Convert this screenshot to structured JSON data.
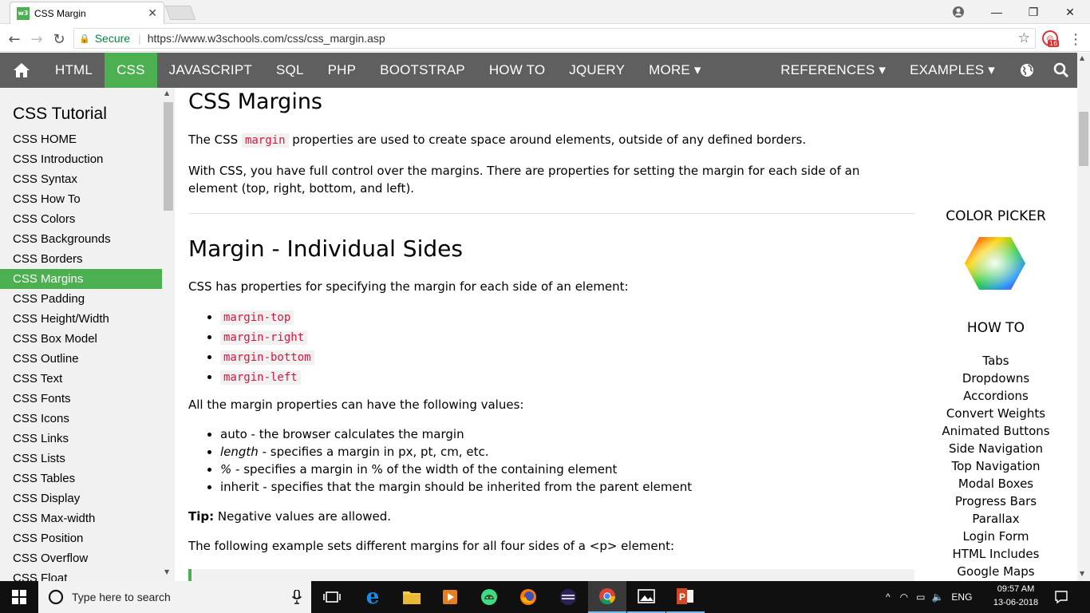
{
  "browser": {
    "tab_title": "CSS Margin",
    "favicon_text": "w3",
    "secure_label": "Secure",
    "url": "https://www.w3schools.com/css/css_margin.asp",
    "extension_badge": "16"
  },
  "topnav": {
    "items": [
      "HTML",
      "CSS",
      "JAVASCRIPT",
      "SQL",
      "PHP",
      "BOOTSTRAP",
      "HOW TO",
      "JQUERY",
      "MORE ▾"
    ],
    "active_index": 1,
    "right_items": [
      "REFERENCES ▾",
      "EXAMPLES ▾"
    ],
    "active_color": "#4caf50",
    "bar_color": "#5f5f5f"
  },
  "sidebar": {
    "title": "CSS Tutorial",
    "items": [
      "CSS HOME",
      "CSS Introduction",
      "CSS Syntax",
      "CSS How To",
      "CSS Colors",
      "CSS Backgrounds",
      "CSS Borders",
      "CSS Margins",
      "CSS Padding",
      "CSS Height/Width",
      "CSS Box Model",
      "CSS Outline",
      "CSS Text",
      "CSS Fonts",
      "CSS Icons",
      "CSS Links",
      "CSS Lists",
      "CSS Tables",
      "CSS Display",
      "CSS Max-width",
      "CSS Position",
      "CSS Overflow",
      "CSS Float"
    ],
    "active_index": 7
  },
  "main": {
    "title": "CSS Margins",
    "intro_pre": "The CSS ",
    "intro_code": "margin",
    "intro_post": " properties are used to create space around elements, outside of any defined borders.",
    "para2": "With CSS, you have full control over the margins. There are properties for setting the margin for each side of an element (top, right, bottom, and left).",
    "section_title": "Margin - Individual Sides",
    "section_intro": "CSS has properties for specifying the margin for each side of an element:",
    "props": [
      "margin-top",
      "margin-right",
      "margin-bottom",
      "margin-left"
    ],
    "values_intro": "All the margin properties can have the following values:",
    "values": [
      {
        "term": "auto",
        "italic": false,
        "desc": " - the browser calculates the margin"
      },
      {
        "term": "length",
        "italic": true,
        "desc": " - specifies a margin in px, pt, cm, etc."
      },
      {
        "term": "%",
        "italic": true,
        "desc": " - specifies a margin in % of the width of the containing element"
      },
      {
        "term": "inherit",
        "italic": false,
        "desc": " - specifies that the margin should be inherited from the parent element"
      }
    ],
    "tip_label": "Tip:",
    "tip_text": " Negative values are allowed.",
    "example_intro": "The following example sets different margins for all four sides of a <p> element:"
  },
  "right": {
    "color_picker": "COLOR PICKER",
    "howto_title": "HOW TO",
    "howto_items": [
      "Tabs",
      "Dropdowns",
      "Accordions",
      "Convert Weights",
      "Animated Buttons",
      "Side Navigation",
      "Top Navigation",
      "Modal Boxes",
      "Progress Bars",
      "Parallax",
      "Login Form",
      "HTML Includes",
      "Google Maps"
    ]
  },
  "taskbar": {
    "search_placeholder": "Type here to search",
    "language": "ENG",
    "time": "09:57 AM",
    "date": "13-06-2018"
  }
}
